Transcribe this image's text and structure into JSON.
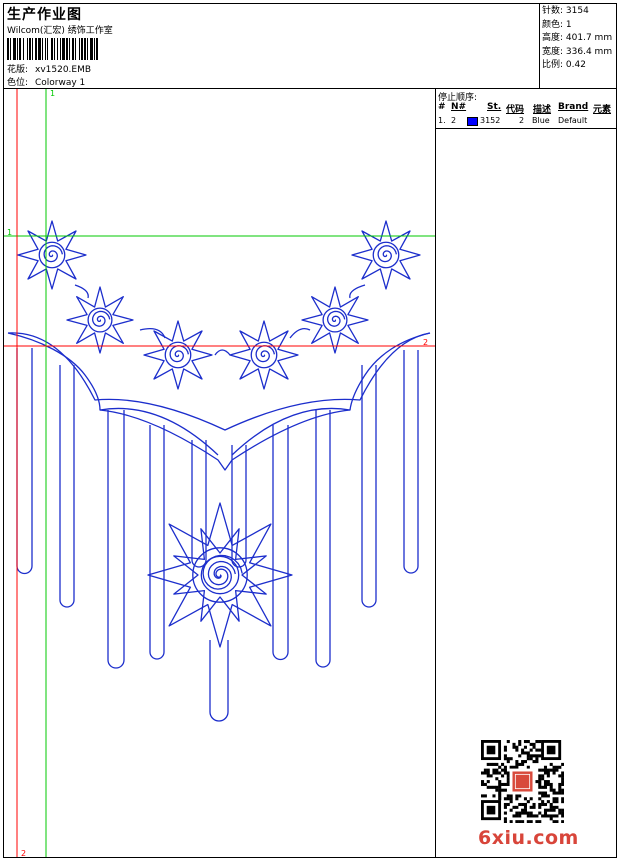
{
  "header": {
    "title": "生产作业图",
    "company": "Wilcom(汇宏) 绣饰工作室",
    "design_file_label": "花版:",
    "design_file": "xv1520.EMB",
    "colorway_label": "色位:",
    "colorway": "Colorway 1"
  },
  "info": {
    "stitches_label": "针数:",
    "stitches": "3154",
    "colors_label": "颜色:",
    "colors": "1",
    "height_label": "高度:",
    "height": "401.7 mm",
    "width_label": "宽度:",
    "width": "336.4 mm",
    "scale_label": "比例:",
    "scale": "0.42"
  },
  "stop_sequence": {
    "title": "停止顺序:",
    "columns": [
      "#",
      "N#",
      "St.",
      "代码",
      "描述",
      "Brand",
      "元素"
    ],
    "rows": [
      {
        "index": "1.",
        "needle": "2",
        "stitches": "3152",
        "code": "2",
        "description": "Blue",
        "brand": "Default",
        "color": "#0000ff"
      }
    ]
  },
  "guides": {
    "h1_label": "1",
    "h2_label": "2",
    "v1_label": "1",
    "v2_label": "2",
    "green": "#00c800",
    "red": "#ff0000"
  },
  "design_color": "#1c2ecc",
  "watermark": "6xiu.com"
}
